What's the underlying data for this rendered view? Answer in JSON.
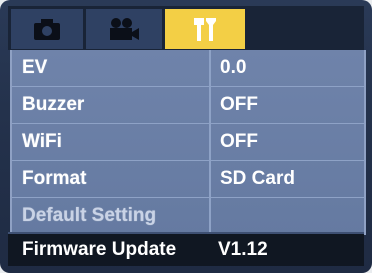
{
  "tabs": [
    {
      "icon": "camera-icon",
      "active": false
    },
    {
      "icon": "video-camera-icon",
      "active": false
    },
    {
      "icon": "settings-tools-icon",
      "active": true
    }
  ],
  "colors": {
    "active_tab": "#f3cf45",
    "menu_bg": "#6f83aa",
    "selected_row_bg": "#101722"
  },
  "menu": {
    "items": [
      {
        "label": "EV",
        "value": "0.0"
      },
      {
        "label": "Buzzer",
        "value": "OFF"
      },
      {
        "label": "WiFi",
        "value": "OFF"
      },
      {
        "label": "Format",
        "value": "SD Card"
      },
      {
        "label": "Default Setting",
        "value": ""
      }
    ],
    "selected": {
      "label": "Firmware Update",
      "value": "V1.12"
    }
  }
}
